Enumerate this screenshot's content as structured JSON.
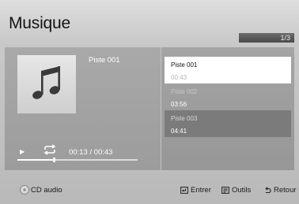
{
  "header": {
    "title": "Musique",
    "page_indicator": "1/3"
  },
  "now_playing": {
    "track_name": "Piste 001",
    "time": "00:13 / 00:43",
    "progress": 0.3,
    "play_icon": "play-icon",
    "repeat_icon": "repeat-icon",
    "album_icon": "music-note-icon"
  },
  "playlist": [
    {
      "title": "Piste 001",
      "duration": "00:43",
      "state": "selected"
    },
    {
      "title": "Piste 002",
      "duration": "03:56",
      "state": "normal"
    },
    {
      "title": "Piste 003",
      "duration": "04:41",
      "state": "dim"
    }
  ],
  "footer": {
    "source_label": "CD audio",
    "source_icon": "cd-icon",
    "enter_label": "Entrer",
    "enter_icon": "enter-icon",
    "tools_label": "Outils",
    "tools_icon": "tools-icon",
    "return_label": "Retour",
    "return_icon": "return-icon"
  }
}
